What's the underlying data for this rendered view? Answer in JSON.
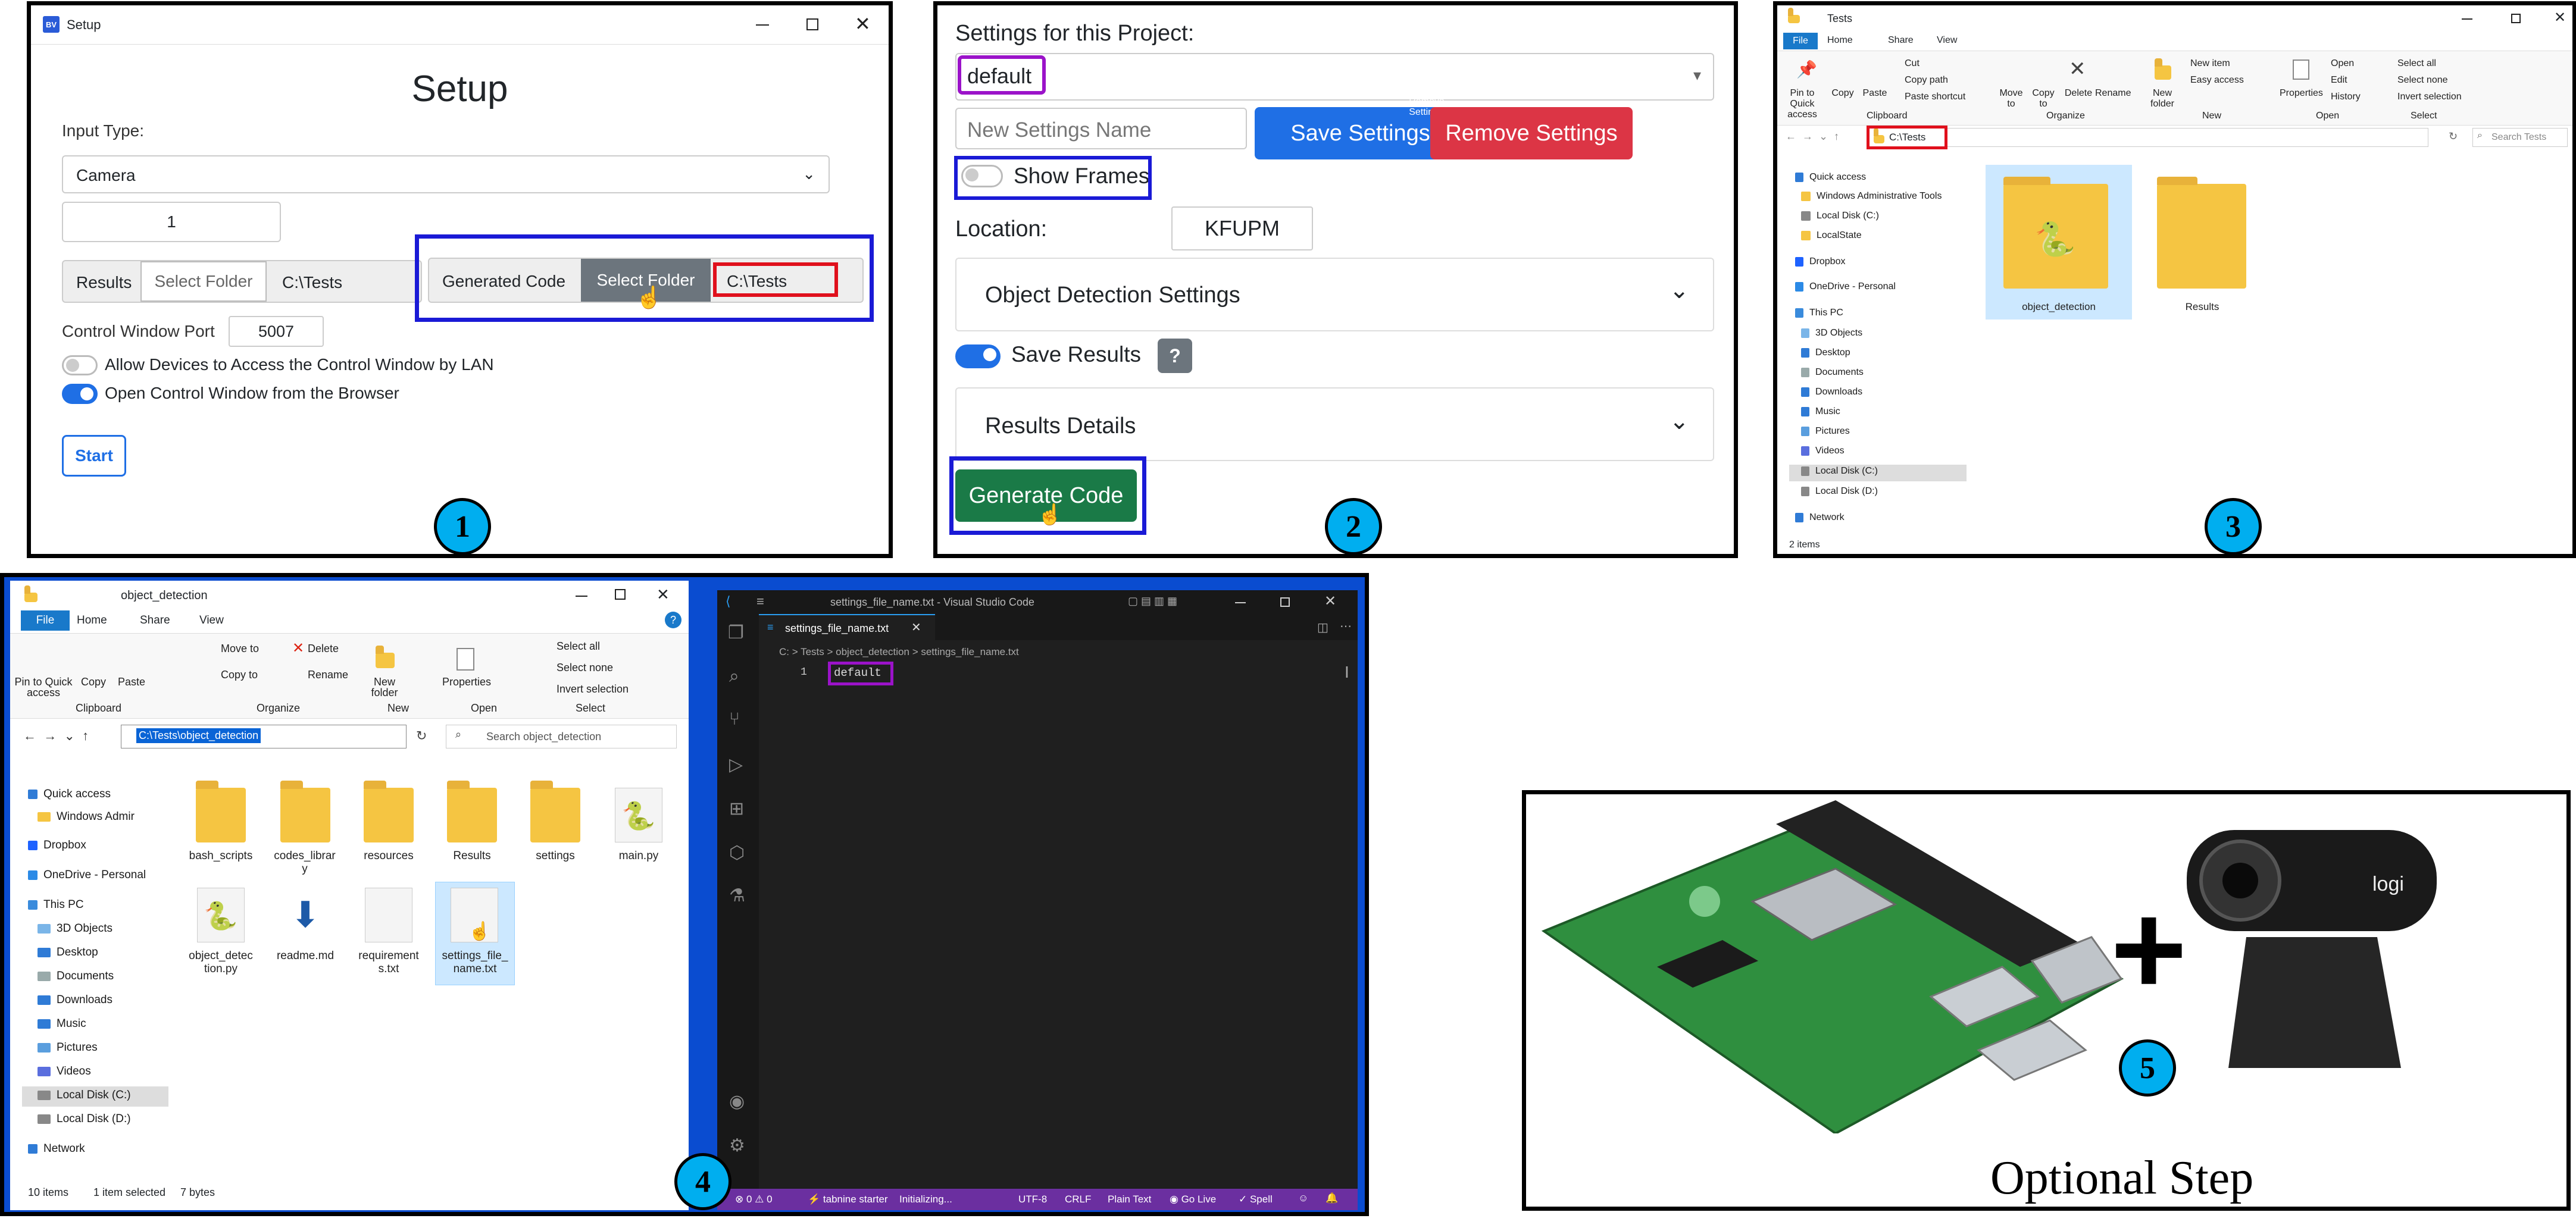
{
  "colors": {
    "primary": "#1f6fe5",
    "danger": "#dc3545",
    "success": "#1a7a47",
    "highlight_blue": "#1a1ad6",
    "highlight_red": "#e0101c",
    "highlight_purple": "#9b13c9",
    "step_circle": "#00aeef",
    "vscode_bg": "#1f1f1f",
    "vscode_status": "#6b2fa0",
    "explorer_selected": "#cce8ff"
  },
  "panel1": {
    "window_title": "Setup",
    "app_icon_label": "BV",
    "heading": "Setup",
    "input_type_label": "Input Type:",
    "input_type_value": "Camera",
    "camera_index": "1",
    "results_label": "Results",
    "select_folder_1": "Select Folder",
    "results_path": "C:\\Tests",
    "generated_code_label": "Generated Code",
    "select_folder_2": "Select Folder",
    "generated_path": "C:\\Tests",
    "port_label": "Control Window Port",
    "port_value": "5007",
    "allow_lan_label": "Allow Devices to Access the Control Window by LAN",
    "open_browser_label": "Open Control Window from the Browser",
    "start_label": "Start",
    "step": "1"
  },
  "panel2": {
    "settings_label": "Settings for this Project:",
    "settings_value": "default",
    "new_settings_placeholder": "New Settings Name",
    "save_settings": "Save Settings",
    "remove_settings": "Remove Settings",
    "show_frames": "Show Frames",
    "location_label": "Location:",
    "location_value": "KFUPM",
    "object_detection_settings": "Object Detection Settings",
    "save_results": "Save Results",
    "help": "?",
    "results_details": "Results Details",
    "generate_code": "Generate Code",
    "step": "2"
  },
  "panel3": {
    "window_title": "Tests",
    "tabs": [
      "File",
      "Home",
      "Share",
      "View"
    ],
    "ribbon": {
      "pin": "Pin to Quick access",
      "copy": "Copy",
      "paste": "Paste",
      "cut": "Cut",
      "copy_path": "Copy path",
      "paste_shortcut": "Paste shortcut",
      "move_to": "Move to",
      "copy_to": "Copy to",
      "delete": "Delete",
      "rename": "Rename",
      "new_folder": "New folder",
      "new_item": "New item",
      "easy_access": "Easy access",
      "properties": "Properties",
      "open": "Open",
      "edit": "Edit",
      "history": "History",
      "select_all": "Select all",
      "select_none": "Select none",
      "invert_selection": "Invert selection",
      "groups": [
        "Clipboard",
        "Organize",
        "New",
        "Open",
        "Select"
      ]
    },
    "address": "C:\\Tests",
    "search_placeholder": "Search Tests",
    "tree": [
      "Quick access",
      "Windows Administrative Tools",
      "Local Disk (C:)",
      "LocalState",
      "Dropbox",
      "OneDrive - Personal",
      "This PC",
      "3D Objects",
      "Desktop",
      "Documents",
      "Downloads",
      "Music",
      "Pictures",
      "Videos",
      "Local Disk (C:)",
      "Local Disk (D:)",
      "Network"
    ],
    "files": [
      "object_detection",
      "Results"
    ],
    "status": "2 items",
    "step": "3"
  },
  "panel4": {
    "window_title": "object_detection",
    "tabs": [
      "File",
      "Home",
      "Share",
      "View"
    ],
    "ribbon": {
      "pin": "Pin to Quick access",
      "copy": "Copy",
      "paste": "Paste",
      "move_to": "Move to",
      "copy_to": "Copy to",
      "delete": "Delete",
      "rename": "Rename",
      "new_folder": "New folder",
      "properties": "Properties",
      "select_all": "Select all",
      "select_none": "Select none",
      "invert_selection": "Invert selection",
      "groups": [
        "Clipboard",
        "Organize",
        "New",
        "Open",
        "Select"
      ]
    },
    "address": "C:\\Tests\\object_detection",
    "search_placeholder": "Search object_detection",
    "tree": [
      "Quick access",
      "Windows Admir",
      "Dropbox",
      "OneDrive - Personal",
      "This PC",
      "3D Objects",
      "Desktop",
      "Documents",
      "Downloads",
      "Music",
      "Pictures",
      "Videos",
      "Local Disk (C:)",
      "Local Disk (D:)",
      "Network"
    ],
    "files": [
      "bash_scripts",
      "codes_librar y",
      "resources",
      "Results",
      "settings",
      "main.py",
      "object_detec tion.py",
      "readme.md",
      "requirement s.txt",
      "settings_file_ name.txt"
    ],
    "status_items": "10 items",
    "status_selected": "1 item selected",
    "status_size": "7 bytes",
    "vscode": {
      "title": "settings_file_name.txt - Visual Studio Code",
      "tab": "settings_file_name.txt",
      "breadcrumb": [
        "C:",
        "Tests",
        "object_detection",
        "settings_file_name.txt"
      ],
      "line_number": "1",
      "code": "default",
      "status": {
        "problems": "0",
        "warnings": "0",
        "tabnine": "tabnine starter",
        "initializing": "Initializing...",
        "encoding": "UTF-8",
        "eol": "CRLF",
        "language": "Plain Text",
        "golive": "Go Live",
        "spell": "Spell"
      }
    },
    "step": "4"
  },
  "panel5": {
    "caption": "Optional Step",
    "logo": "logi",
    "plus": "+",
    "step": "5"
  }
}
